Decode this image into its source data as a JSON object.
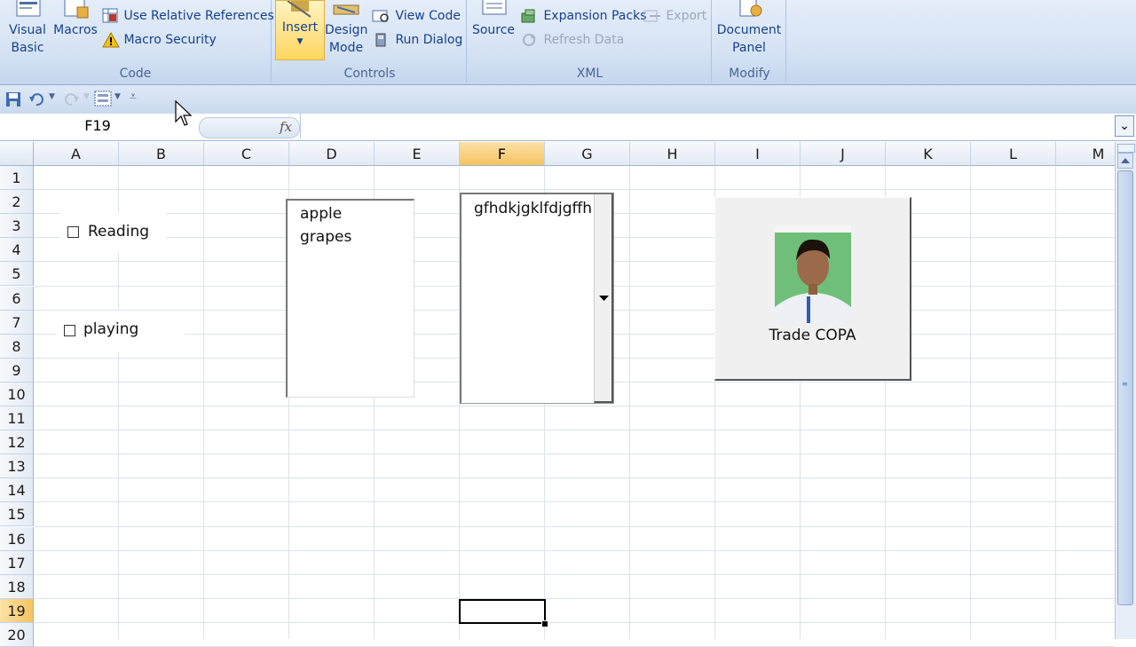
{
  "ribbon": {
    "code_group": {
      "label": "Code",
      "visual_basic": "Visual\nBasic",
      "visual_basic_l1": "Visual",
      "visual_basic_l2": "Basic",
      "macros": "Macros",
      "use_relative_references": "Use Relative References",
      "macro_security": "Macro Security"
    },
    "controls_group": {
      "label": "Controls",
      "insert": "Insert",
      "design_mode_l1": "Design",
      "design_mode_l2": "Mode",
      "view_code": "View Code",
      "run_dialog": "Run Dialog"
    },
    "xml_group": {
      "label": "XML",
      "source": "Source",
      "expansion_packs": "Expansion Packs",
      "refresh_data": "Refresh Data",
      "export": "Export"
    },
    "modify_group": {
      "label": "Modify",
      "document_panel_l1": "Document",
      "document_panel_l2": "Panel"
    }
  },
  "formula_bar": {
    "name_box": "F19",
    "fx": "fx",
    "formula": ""
  },
  "sheet": {
    "columns": [
      "A",
      "B",
      "C",
      "D",
      "E",
      "F",
      "G",
      "H",
      "I",
      "J",
      "K",
      "L",
      "M"
    ],
    "selected_column": "F",
    "rows": [
      "1",
      "2",
      "3",
      "4",
      "5",
      "6",
      "7",
      "8",
      "9",
      "10",
      "11",
      "12",
      "13",
      "14",
      "15",
      "16",
      "17",
      "18",
      "19",
      "20"
    ],
    "selected_row": "19",
    "active_cell": "F19"
  },
  "controls": {
    "checkbox_reading": {
      "label": "Reading",
      "checked": false
    },
    "checkbox_playing": {
      "label": "playing",
      "checked": false
    },
    "listbox_items": [
      "apple",
      "grapes"
    ],
    "combobox_value": "gfhdkjgklfdjgffh",
    "image_button_caption": "Trade COPA"
  },
  "colors": {
    "ribbon_text": "#15428b",
    "selection_header": "#f6c35f",
    "gridline": "#dde3ec"
  }
}
